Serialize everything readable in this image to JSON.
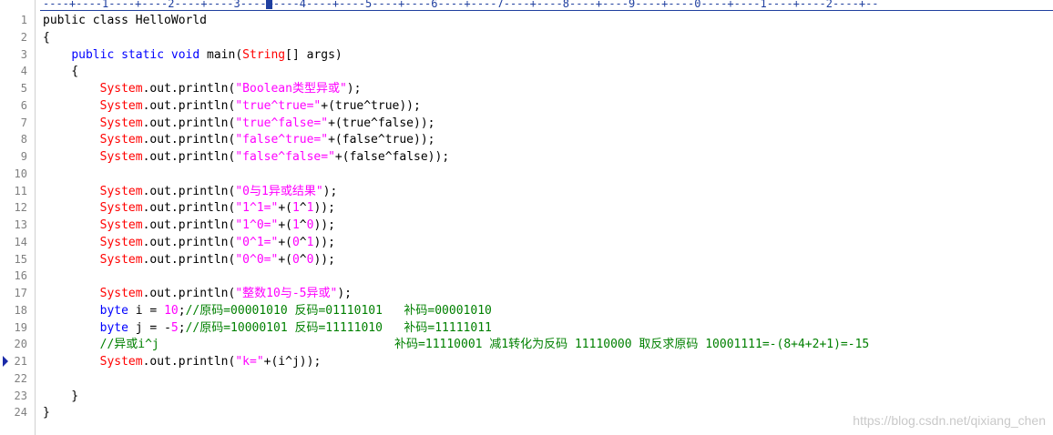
{
  "editor": {
    "ruler": "----+----1----+----2----+----3----+----4----+----5----+----6----+----7----+----8----+----9----+----0----+----1----+----2----+--",
    "breakpoint_line": 21,
    "lines": [
      {
        "n": "1",
        "segments": [
          {
            "t": "public class HelloWorld",
            "c": ""
          }
        ]
      },
      {
        "n": "2",
        "segments": [
          {
            "t": "{",
            "c": ""
          }
        ]
      },
      {
        "n": "3",
        "segments": [
          {
            "t": "    ",
            "c": ""
          },
          {
            "t": "public static void",
            "c": "kw"
          },
          {
            "t": " main(",
            "c": ""
          },
          {
            "t": "String",
            "c": "ty"
          },
          {
            "t": "[] args)",
            "c": ""
          }
        ]
      },
      {
        "n": "4",
        "segments": [
          {
            "t": "    {",
            "c": ""
          }
        ]
      },
      {
        "n": "5",
        "segments": [
          {
            "t": "        ",
            "c": ""
          },
          {
            "t": "System",
            "c": "ob"
          },
          {
            "t": ".out.println(",
            "c": ""
          },
          {
            "t": "\"Boolean类型异或\"",
            "c": "st"
          },
          {
            "t": ");",
            "c": ""
          }
        ]
      },
      {
        "n": "6",
        "segments": [
          {
            "t": "        ",
            "c": ""
          },
          {
            "t": "System",
            "c": "ob"
          },
          {
            "t": ".out.println(",
            "c": ""
          },
          {
            "t": "\"true^true=\"",
            "c": "st"
          },
          {
            "t": "+(true^true));",
            "c": ""
          }
        ]
      },
      {
        "n": "7",
        "segments": [
          {
            "t": "        ",
            "c": ""
          },
          {
            "t": "System",
            "c": "ob"
          },
          {
            "t": ".out.println(",
            "c": ""
          },
          {
            "t": "\"true^false=\"",
            "c": "st"
          },
          {
            "t": "+(true^false));",
            "c": ""
          }
        ]
      },
      {
        "n": "8",
        "segments": [
          {
            "t": "        ",
            "c": ""
          },
          {
            "t": "System",
            "c": "ob"
          },
          {
            "t": ".out.println(",
            "c": ""
          },
          {
            "t": "\"false^true=\"",
            "c": "st"
          },
          {
            "t": "+(false^true));",
            "c": ""
          }
        ]
      },
      {
        "n": "9",
        "segments": [
          {
            "t": "        ",
            "c": ""
          },
          {
            "t": "System",
            "c": "ob"
          },
          {
            "t": ".out.println(",
            "c": ""
          },
          {
            "t": "\"false^false=\"",
            "c": "st"
          },
          {
            "t": "+(false^false));",
            "c": ""
          }
        ]
      },
      {
        "n": "10",
        "segments": [
          {
            "t": "",
            "c": ""
          }
        ]
      },
      {
        "n": "11",
        "segments": [
          {
            "t": "        ",
            "c": ""
          },
          {
            "t": "System",
            "c": "ob"
          },
          {
            "t": ".out.println(",
            "c": ""
          },
          {
            "t": "\"0与1异或结果\"",
            "c": "st"
          },
          {
            "t": ");",
            "c": ""
          }
        ]
      },
      {
        "n": "12",
        "segments": [
          {
            "t": "        ",
            "c": ""
          },
          {
            "t": "System",
            "c": "ob"
          },
          {
            "t": ".out.println(",
            "c": ""
          },
          {
            "t": "\"1^1=\"",
            "c": "st"
          },
          {
            "t": "+(",
            "c": ""
          },
          {
            "t": "1",
            "c": "nm"
          },
          {
            "t": "^",
            "c": ""
          },
          {
            "t": "1",
            "c": "nm"
          },
          {
            "t": "));",
            "c": ""
          }
        ]
      },
      {
        "n": "13",
        "segments": [
          {
            "t": "        ",
            "c": ""
          },
          {
            "t": "System",
            "c": "ob"
          },
          {
            "t": ".out.println(",
            "c": ""
          },
          {
            "t": "\"1^0=\"",
            "c": "st"
          },
          {
            "t": "+(",
            "c": ""
          },
          {
            "t": "1",
            "c": "nm"
          },
          {
            "t": "^",
            "c": ""
          },
          {
            "t": "0",
            "c": "nm"
          },
          {
            "t": "));",
            "c": ""
          }
        ]
      },
      {
        "n": "14",
        "segments": [
          {
            "t": "        ",
            "c": ""
          },
          {
            "t": "System",
            "c": "ob"
          },
          {
            "t": ".out.println(",
            "c": ""
          },
          {
            "t": "\"0^1=\"",
            "c": "st"
          },
          {
            "t": "+(",
            "c": ""
          },
          {
            "t": "0",
            "c": "nm"
          },
          {
            "t": "^",
            "c": ""
          },
          {
            "t": "1",
            "c": "nm"
          },
          {
            "t": "));",
            "c": ""
          }
        ]
      },
      {
        "n": "15",
        "segments": [
          {
            "t": "        ",
            "c": ""
          },
          {
            "t": "System",
            "c": "ob"
          },
          {
            "t": ".out.println(",
            "c": ""
          },
          {
            "t": "\"0^0=\"",
            "c": "st"
          },
          {
            "t": "+(",
            "c": ""
          },
          {
            "t": "0",
            "c": "nm"
          },
          {
            "t": "^",
            "c": ""
          },
          {
            "t": "0",
            "c": "nm"
          },
          {
            "t": "));",
            "c": ""
          }
        ]
      },
      {
        "n": "16",
        "segments": [
          {
            "t": "",
            "c": ""
          }
        ]
      },
      {
        "n": "17",
        "segments": [
          {
            "t": "        ",
            "c": ""
          },
          {
            "t": "System",
            "c": "ob"
          },
          {
            "t": ".out.println(",
            "c": ""
          },
          {
            "t": "\"整数10与-5异或\"",
            "c": "st"
          },
          {
            "t": ");",
            "c": ""
          }
        ]
      },
      {
        "n": "18",
        "segments": [
          {
            "t": "        ",
            "c": ""
          },
          {
            "t": "byte",
            "c": "kw"
          },
          {
            "t": " i = ",
            "c": ""
          },
          {
            "t": "10",
            "c": "nm"
          },
          {
            "t": ";",
            "c": ""
          },
          {
            "t": "//原码=00001010 反码=01110101   补码=00001010",
            "c": "cm"
          }
        ]
      },
      {
        "n": "19",
        "segments": [
          {
            "t": "        ",
            "c": ""
          },
          {
            "t": "byte",
            "c": "kw"
          },
          {
            "t": " j = -",
            "c": ""
          },
          {
            "t": "5",
            "c": "nm"
          },
          {
            "t": ";",
            "c": ""
          },
          {
            "t": "//原码=10000101 反码=11111010   补码=11111011",
            "c": "cm"
          }
        ]
      },
      {
        "n": "20",
        "segments": [
          {
            "t": "        ",
            "c": ""
          },
          {
            "t": "//异或i^j                                 补码=11110001 减1转化为反码 11110000 取反求原码 10001111=-(8+4+2+1)=-15",
            "c": "cm"
          }
        ]
      },
      {
        "n": "21",
        "segments": [
          {
            "t": "        ",
            "c": ""
          },
          {
            "t": "System",
            "c": "ob"
          },
          {
            "t": ".out.println(",
            "c": ""
          },
          {
            "t": "\"k=\"",
            "c": "st"
          },
          {
            "t": "+(i^j));",
            "c": ""
          }
        ]
      },
      {
        "n": "22",
        "segments": [
          {
            "t": "",
            "c": ""
          }
        ]
      },
      {
        "n": "23",
        "segments": [
          {
            "t": "    }",
            "c": ""
          }
        ]
      },
      {
        "n": "24",
        "segments": [
          {
            "t": "}",
            "c": ""
          }
        ]
      }
    ]
  },
  "watermark": "https://blog.csdn.net/qixiang_chen"
}
